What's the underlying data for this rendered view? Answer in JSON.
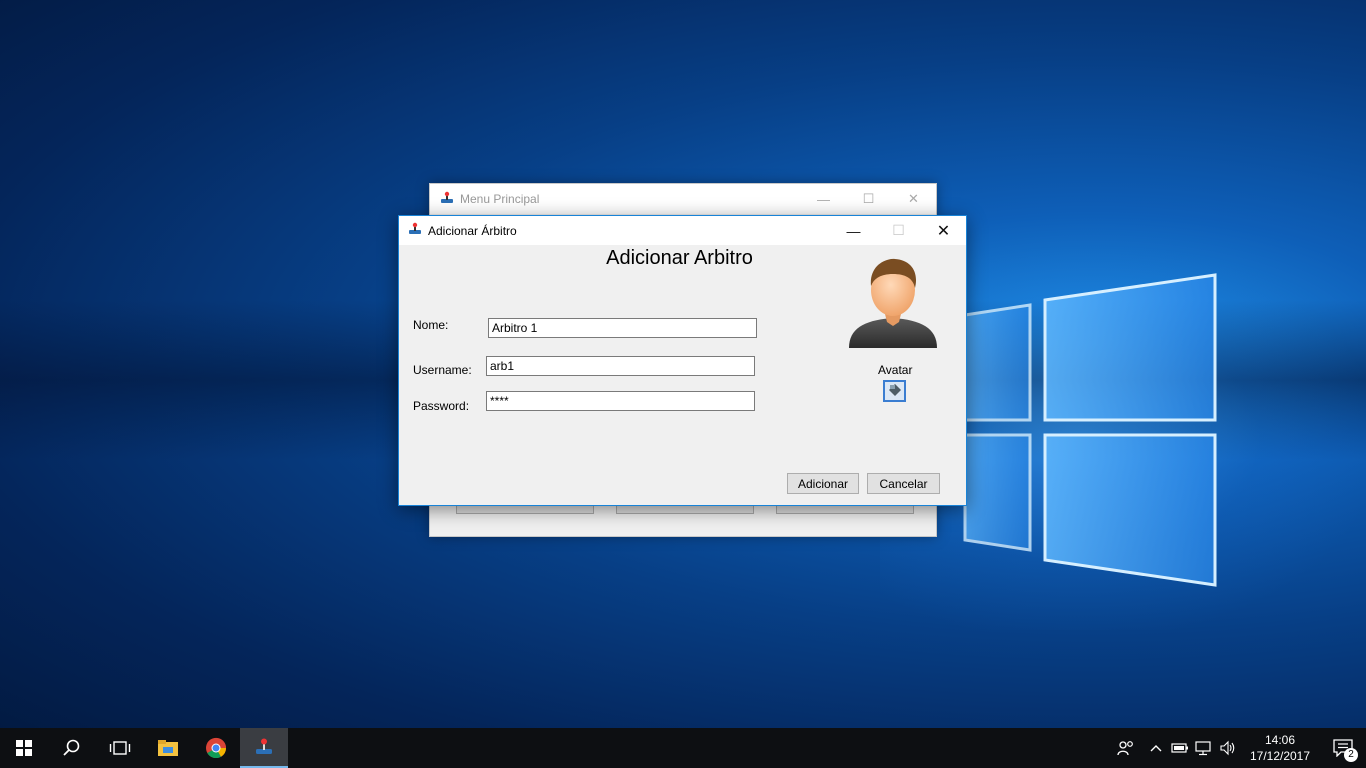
{
  "background_window": {
    "title": "Menu Principal"
  },
  "dialog": {
    "title": "Adicionar Árbitro",
    "heading": "Adicionar Arbitro",
    "fields": {
      "nome_label": "Nome:",
      "nome_value": "Arbitro 1",
      "username_label": "Username:",
      "username_value": "arb1",
      "password_label": "Password:",
      "password_value": "****"
    },
    "avatar_label": "Avatar",
    "buttons": {
      "add": "Adicionar",
      "cancel": "Cancelar"
    }
  },
  "taskbar": {
    "apps": [
      "start-icon",
      "search-icon",
      "task-view-icon",
      "file-explorer-icon",
      "chrome-icon",
      "java-app-icon"
    ],
    "clock_time": "14:06",
    "clock_date": "17/12/2017",
    "notification_count": "2"
  },
  "colors": {
    "accent": "#1883d7",
    "taskbar": "#0d0f12"
  }
}
